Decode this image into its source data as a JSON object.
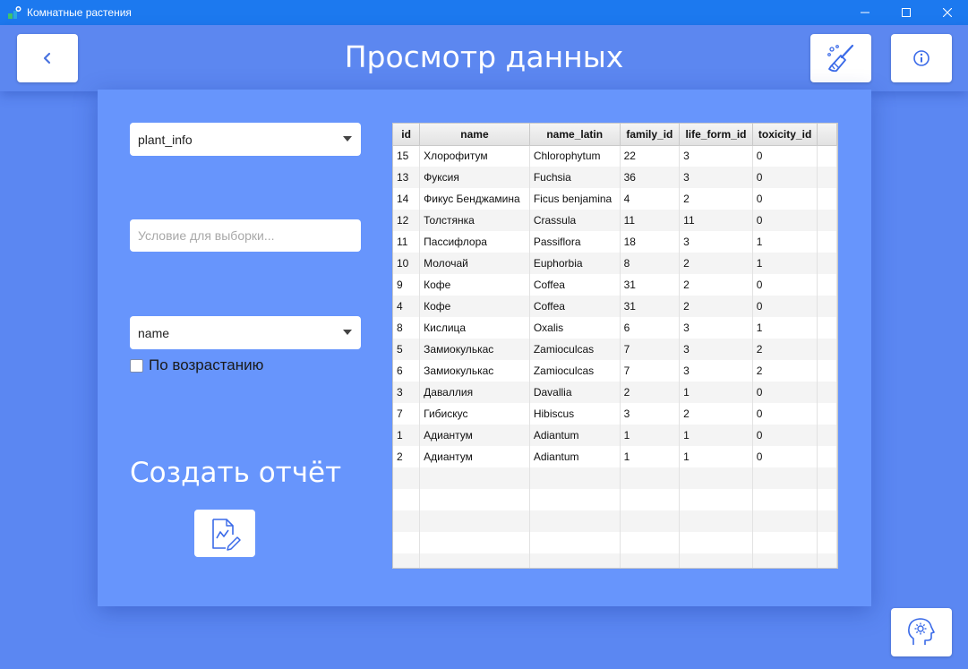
{
  "window": {
    "title": "Комнатные растения"
  },
  "header": {
    "title": "Просмотр данных"
  },
  "icons": {
    "back": "chevron-left-icon",
    "clear": "broom-icon",
    "info": "info-icon",
    "report": "report-chart-icon",
    "settings": "settings-head-icon"
  },
  "colors": {
    "titlebar": "#1c79ef",
    "background": "#5b87f2",
    "panel": "#6795fc",
    "accent": "#3a6ae8"
  },
  "controls": {
    "table_select": "plant_info",
    "condition": {
      "value": "",
      "placeholder": "Условие для выборки..."
    },
    "sort_select": "name",
    "ascending_label": "По возрастанию",
    "ascending_checked": false
  },
  "report": {
    "title": "Создать отчёт"
  },
  "table": {
    "columns": [
      "id",
      "name",
      "name_latin",
      "family_id",
      "life_form_id",
      "toxicity_id"
    ],
    "rows": [
      [
        "15",
        "Хлорофитум",
        "Chlorophytum",
        "22",
        "3",
        "0"
      ],
      [
        "13",
        "Фуксия",
        "Fuchsia",
        "36",
        "3",
        "0"
      ],
      [
        "14",
        "Фикус Бенджамина",
        "Ficus benjamina",
        "4",
        "2",
        "0"
      ],
      [
        "12",
        "Толстянка",
        "Crassula",
        "11",
        "11",
        "0"
      ],
      [
        "11",
        "Пассифлора",
        "Passiflora",
        "18",
        "3",
        "1"
      ],
      [
        "10",
        "Молочай",
        "Euphorbia",
        "8",
        "2",
        "1"
      ],
      [
        "9",
        "Кофе",
        "Coffea",
        "31",
        "2",
        "0"
      ],
      [
        "4",
        "Кофе",
        "Coffea",
        "31",
        "2",
        "0"
      ],
      [
        "8",
        "Кислица",
        "Oxalis",
        "6",
        "3",
        "1"
      ],
      [
        "5",
        "Замиокулькас",
        "Zamioculcas",
        "7",
        "3",
        "2"
      ],
      [
        "6",
        "Замиокулькас",
        "Zamioculcas",
        "7",
        "3",
        "2"
      ],
      [
        "3",
        "Даваллия",
        "Davallia",
        "2",
        "1",
        "0"
      ],
      [
        "7",
        "Гибискус",
        "Hibiscus",
        "3",
        "2",
        "0"
      ],
      [
        "1",
        "Адиантум",
        "Adiantum",
        "1",
        "1",
        "0"
      ],
      [
        "2",
        "Адиантум",
        "Adiantum",
        "1",
        "1",
        "0"
      ]
    ],
    "empty_rows": 5
  }
}
